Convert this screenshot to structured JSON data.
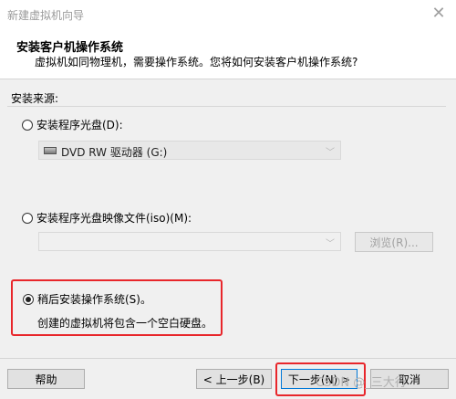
{
  "window": {
    "title": "新建虚拟机向导",
    "close_glyph": "✕"
  },
  "header": {
    "title": "安装客户机操作系统",
    "subtitle": "虚拟机如同物理机，需要操作系统。您将如何安装客户机操作系统?"
  },
  "install_source": {
    "label": "安装来源:",
    "options": [
      {
        "label": "安装程序光盘(D):",
        "checked": false
      },
      {
        "label": "安装程序光盘映像文件(iso)(M):",
        "checked": false
      },
      {
        "label": "稍后安装操作系统(S)。",
        "checked": true,
        "description": "创建的虚拟机将包含一个空白硬盘。"
      }
    ],
    "disc_select": {
      "value": "DVD RW 驱动器 (G:)",
      "chevron": "﹀"
    },
    "iso_select": {
      "value": "",
      "chevron": "﹀"
    },
    "browse_label": "浏览(R)..."
  },
  "footer": {
    "help_label": "帮助",
    "back_label": "< 上一步(B)",
    "next_label": "下一步(N) >",
    "cancel_label": "取消"
  },
  "watermark": "CSDN @_三大行_",
  "highlight_color": "#e8262b"
}
